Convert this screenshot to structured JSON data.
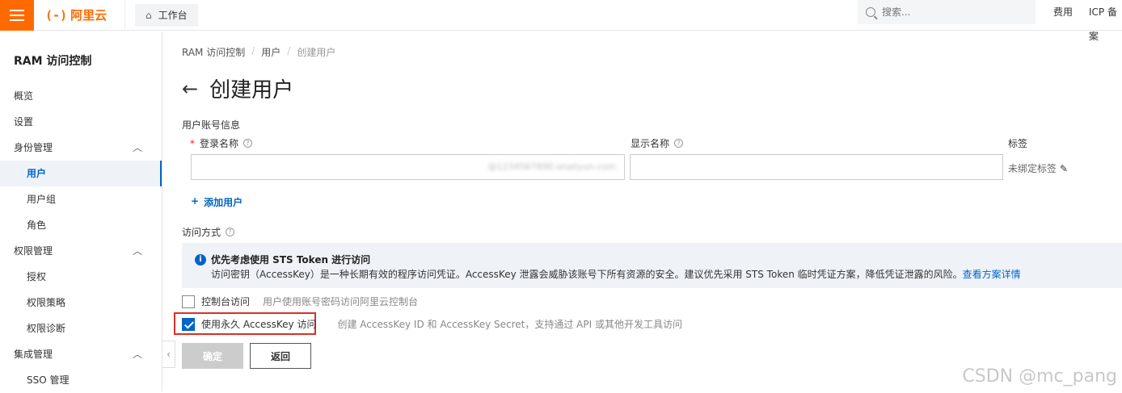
{
  "topbar": {
    "brand_mark": "(-)",
    "brand_name": "阿里云",
    "workbench": "工作台",
    "search_placeholder": "搜索...",
    "links": [
      "费用",
      "ICP 备案"
    ]
  },
  "sidebar": {
    "title": "RAM 访问控制",
    "items": [
      {
        "label": "概览",
        "sub": false
      },
      {
        "label": "设置",
        "sub": false
      },
      {
        "label": "身份管理",
        "sub": false,
        "group": true
      },
      {
        "label": "用户",
        "sub": true,
        "active": true
      },
      {
        "label": "用户组",
        "sub": true
      },
      {
        "label": "角色",
        "sub": true
      },
      {
        "label": "权限管理",
        "sub": false,
        "group": true
      },
      {
        "label": "授权",
        "sub": true
      },
      {
        "label": "权限策略",
        "sub": true
      },
      {
        "label": "权限诊断",
        "sub": true
      },
      {
        "label": "集成管理",
        "sub": false,
        "group": true
      },
      {
        "label": "SSO 管理",
        "sub": true
      }
    ]
  },
  "breadcrumb": [
    "RAM 访问控制",
    "用户",
    "创建用户"
  ],
  "page_title": "创建用户",
  "form": {
    "section_account": "用户账号信息",
    "login_name_label": "登录名称",
    "login_name_suffix": "@1234567890.onaliyun.com",
    "display_name_label": "显示名称",
    "tag_label": "标签",
    "tag_value": "未绑定标签",
    "add_user": "添加用户",
    "section_access": "访问方式"
  },
  "notice": {
    "title": "优先考虑使用 STS Token 进行访问",
    "body": "访问密钥（AccessKey）是一种长期有效的程序访问凭证。AccessKey 泄露会威胁该账号下所有资源的安全。建议优先采用 STS Token 临时凭证方案，降低凭证泄露的风险。",
    "link": "查看方案详情"
  },
  "access": {
    "console": {
      "label": "控制台访问",
      "desc": "用户使用账号密码访问阿里云控制台",
      "checked": false
    },
    "accesskey": {
      "label": "使用永久 AccessKey 访问",
      "desc": "创建 AccessKey ID 和 AccessKey Secret，支持通过 API 或其他开发工具访问",
      "checked": true
    }
  },
  "buttons": {
    "ok": "确定",
    "back": "返回"
  },
  "watermark": "CSDN @mc_pang",
  "colors": {
    "brand": "#ff6a00",
    "primary": "#0064c8",
    "highlight": "#d93026"
  }
}
